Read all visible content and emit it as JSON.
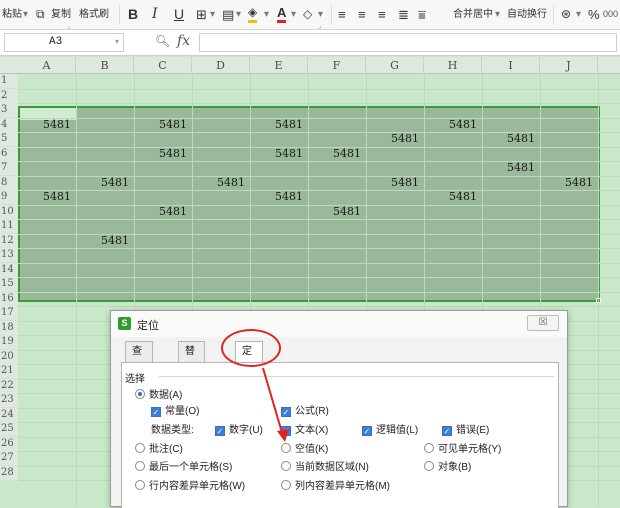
{
  "ribbon": {
    "paste": "粘贴",
    "copy": "复制",
    "format_painter": "格式刷",
    "bold": "B",
    "italic": "I",
    "underline": "U",
    "merge_center": "合并居中",
    "wrap_text": "自动换行",
    "percent": "%",
    "dd": "·"
  },
  "formula_bar": {
    "cell_ref": "A3",
    "fx": "fx"
  },
  "columns": [
    "A",
    "B",
    "C",
    "D",
    "E",
    "F",
    "G",
    "H",
    "I",
    "J"
  ],
  "rows": [
    "1",
    "2",
    "3",
    "4",
    "5",
    "6",
    "7",
    "8",
    "9",
    "10",
    "11",
    "12",
    "13",
    "14",
    "15",
    "16",
    "17",
    "18",
    "19",
    "20",
    "21",
    "22",
    "23",
    "24",
    "25",
    "26",
    "27",
    "28"
  ],
  "cells": [
    {
      "row": 4,
      "col": "A",
      "value": "5481"
    },
    {
      "row": 4,
      "col": "C",
      "value": "5481"
    },
    {
      "row": 4,
      "col": "E",
      "value": "5481"
    },
    {
      "row": 4,
      "col": "H",
      "value": "5481"
    },
    {
      "row": 5,
      "col": "G",
      "value": "5481"
    },
    {
      "row": 5,
      "col": "I",
      "value": "5481"
    },
    {
      "row": 6,
      "col": "C",
      "value": "5481"
    },
    {
      "row": 6,
      "col": "E",
      "value": "5481"
    },
    {
      "row": 6,
      "col": "F",
      "value": "5481"
    },
    {
      "row": 7,
      "col": "I",
      "value": "5481"
    },
    {
      "row": 8,
      "col": "B",
      "value": "5481"
    },
    {
      "row": 8,
      "col": "D",
      "value": "5481"
    },
    {
      "row": 8,
      "col": "G",
      "value": "5481"
    },
    {
      "row": 8,
      "col": "J",
      "value": "5481"
    },
    {
      "row": 9,
      "col": "A",
      "value": "5481"
    },
    {
      "row": 9,
      "col": "E",
      "value": "5481"
    },
    {
      "row": 9,
      "col": "H",
      "value": "5481"
    },
    {
      "row": 10,
      "col": "C",
      "value": "5481"
    },
    {
      "row": 10,
      "col": "F",
      "value": "5481"
    },
    {
      "row": 12,
      "col": "B",
      "value": "5481"
    }
  ],
  "dialog": {
    "title": "定位",
    "close": "☒",
    "tabs": {
      "find": "查找(D)",
      "replace": "替换(P)",
      "goto": "定位(G)"
    },
    "group_label": "选择",
    "data": "数据(A)",
    "constants": "常量(O)",
    "formulas": "公式(R)",
    "data_type_label": "数据类型:",
    "numbers": "数字(U)",
    "text": "文本(X)",
    "logicals": "逻辑值(L)",
    "errors": "错误(E)",
    "comments": "批注(C)",
    "blanks": "空值(K)",
    "visible_cells": "可见单元格(Y)",
    "last_cell": "最后一个单元格(S)",
    "current_region": "当前数据区域(N)",
    "objects": "对象(B)",
    "row_differences": "行内容差异单元格(W)",
    "column_differences": "列内容差异单元格(M)"
  },
  "colors": {
    "accent": "#2e9f2e",
    "annotation": "#e0251f"
  }
}
